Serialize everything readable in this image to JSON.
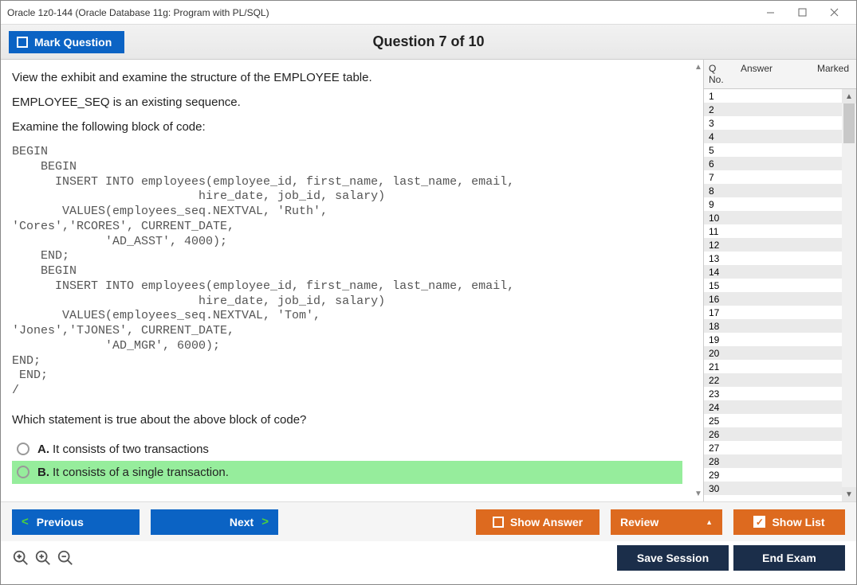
{
  "window": {
    "title": "Oracle 1z0-144 (Oracle Database 11g: Program with PL/SQL)"
  },
  "toolbar": {
    "mark_label": "Mark Question",
    "counter": "Question 7 of 10"
  },
  "question": {
    "para1": "View the exhibit and examine the structure of the EMPLOYEE table.",
    "para2": "EMPLOYEE_SEQ is an existing sequence.",
    "para3": "Examine the following block of code:",
    "code": "BEGIN\n    BEGIN\n      INSERT INTO employees(employee_id, first_name, last_name, email,\n                          hire_date, job_id, salary)\n       VALUES(employees_seq.NEXTVAL, 'Ruth',\n'Cores','RCORES', CURRENT_DATE,\n             'AD_ASST', 4000);\n    END;\n    BEGIN\n      INSERT INTO employees(employee_id, first_name, last_name, email,\n                          hire_date, job_id, salary)\n       VALUES(employees_seq.NEXTVAL, 'Tom',\n'Jones','TJONES', CURRENT_DATE,\n             'AD_MGR', 6000);\nEND;\n END;\n/",
    "prompt": "Which statement is true about the above block of code?",
    "options": [
      {
        "letter": "A.",
        "text": "It consists of two transactions",
        "selected": false
      },
      {
        "letter": "B.",
        "text": "It consists of a single transaction.",
        "selected": true
      }
    ]
  },
  "side": {
    "headers": {
      "qno": "Q No.",
      "answer": "Answer",
      "marked": "Marked"
    },
    "rows": [
      {
        "q": "1"
      },
      {
        "q": "2"
      },
      {
        "q": "3"
      },
      {
        "q": "4"
      },
      {
        "q": "5"
      },
      {
        "q": "6"
      },
      {
        "q": "7"
      },
      {
        "q": "8"
      },
      {
        "q": "9"
      },
      {
        "q": "10"
      },
      {
        "q": "11"
      },
      {
        "q": "12"
      },
      {
        "q": "13"
      },
      {
        "q": "14"
      },
      {
        "q": "15"
      },
      {
        "q": "16"
      },
      {
        "q": "17"
      },
      {
        "q": "18"
      },
      {
        "q": "19"
      },
      {
        "q": "20"
      },
      {
        "q": "21"
      },
      {
        "q": "22"
      },
      {
        "q": "23"
      },
      {
        "q": "24"
      },
      {
        "q": "25"
      },
      {
        "q": "26"
      },
      {
        "q": "27"
      },
      {
        "q": "28"
      },
      {
        "q": "29"
      },
      {
        "q": "30"
      }
    ]
  },
  "buttons": {
    "previous": "Previous",
    "next": "Next",
    "show_answer": "Show Answer",
    "review": "Review",
    "show_list": "Show List",
    "save_session": "Save Session",
    "end_exam": "End Exam"
  }
}
